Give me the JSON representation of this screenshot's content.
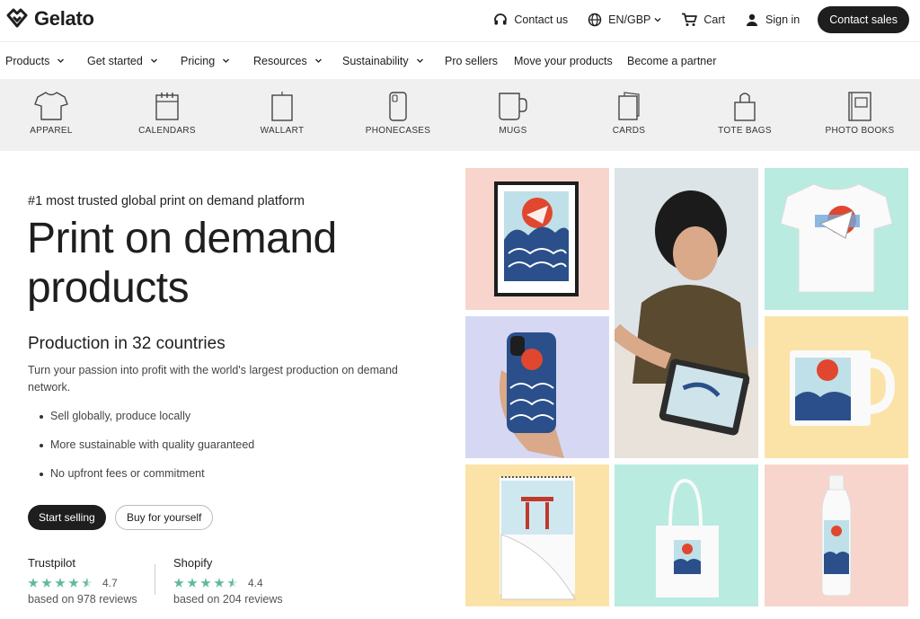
{
  "brand": {
    "name": "Gelato"
  },
  "top_actions": {
    "contact": "Contact us",
    "locale": "EN/GBP",
    "cart": "Cart",
    "sign_in": "Sign in",
    "contact_sales": "Contact sales"
  },
  "nav": [
    {
      "label": "Products",
      "dropdown": true
    },
    {
      "label": "Get started",
      "dropdown": true
    },
    {
      "label": "Pricing",
      "dropdown": true
    },
    {
      "label": "Resources",
      "dropdown": true
    },
    {
      "label": "Sustainability",
      "dropdown": true
    },
    {
      "label": "Pro sellers",
      "dropdown": false
    },
    {
      "label": "Move your products",
      "dropdown": false
    },
    {
      "label": "Become a partner",
      "dropdown": false
    }
  ],
  "categories": [
    {
      "label": "APPAREL",
      "icon": "tshirt-icon"
    },
    {
      "label": "CALENDARS",
      "icon": "calendar-icon"
    },
    {
      "label": "WALLART",
      "icon": "wallart-icon"
    },
    {
      "label": "PHONECASES",
      "icon": "phonecase-icon"
    },
    {
      "label": "MUGS",
      "icon": "mug-icon"
    },
    {
      "label": "CARDS",
      "icon": "cards-icon"
    },
    {
      "label": "TOTE BAGS",
      "icon": "totebag-icon"
    },
    {
      "label": "PHOTO BOOKS",
      "icon": "photobook-icon"
    }
  ],
  "hero": {
    "eyebrow": "#1 most trusted global print on demand platform",
    "title_line1": "Print on demand",
    "title_line2": "products",
    "subtitle": "Production in 32 countries",
    "description": "Turn your passion into profit with the world's largest production on demand network.",
    "bullets": [
      "Sell globally, produce locally",
      "More sustainable with quality guaranteed",
      "No upfront fees or commitment"
    ],
    "cta_primary": "Start selling",
    "cta_secondary": "Buy for yourself"
  },
  "reviews": [
    {
      "source": "Trustpilot",
      "rating": "4.7",
      "stars": 4.5,
      "count_text": "based on 978 reviews"
    },
    {
      "source": "Shopify",
      "rating": "4.4",
      "stars": 4.5,
      "count_text": "based on 204 reviews"
    }
  ],
  "colors": {
    "dark": "#1e1e1e",
    "star": "#5fb99a",
    "tile_pink": "#f8d5cc",
    "tile_lavender": "#d6d8f3",
    "tile_mint": "#b9ebe0",
    "tile_yellow": "#fbe3a8"
  }
}
